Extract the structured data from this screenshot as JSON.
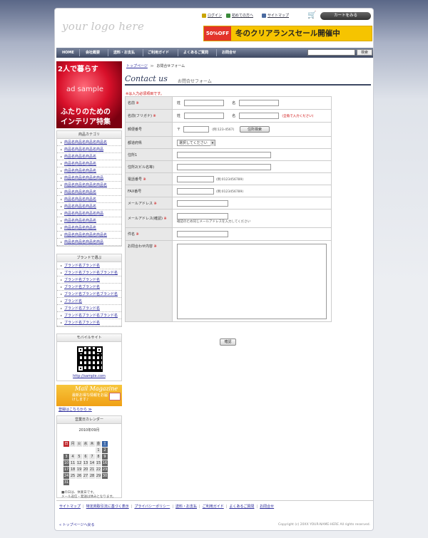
{
  "header": {
    "logo": "your logo here",
    "top_links": [
      "ログイン",
      "初めての方へ",
      "サイトマップ"
    ],
    "cart_button": "カートをみる",
    "banner_badge": "50%OFF",
    "banner_text": "冬のクリアランスセール開催中"
  },
  "nav": {
    "items": [
      "HOME",
      "会社概要",
      "送料・お支払",
      "ご利用ガイド",
      "よくあるご質問",
      "お問合せ"
    ],
    "search_button": "検索"
  },
  "side_ad": {
    "line1": "2人で暮らす",
    "line2": "ad sample",
    "line3": "ふたりのための",
    "line4": "インテリア特集"
  },
  "categories": {
    "title": "商品カテゴリ",
    "items": [
      "商品名商品名商品名商品名",
      "商品名商品名商品名商品",
      "商品名商品名商品名",
      "商品名商品名商品名",
      "商品名商品名商品名",
      "商品名商品名商品名商品",
      "商品名商品名商品名商品名",
      "商品名商品名商品名",
      "商品名商品名商品名",
      "商品名商品名商品名",
      "商品名商品名商品名商品",
      "商品名商品名商品名",
      "商品名商品名商品名",
      "商品名商品名商品名商品名",
      "商品名商品名商品名商品"
    ]
  },
  "brands": {
    "title": "ブランドで選ぶ",
    "items": [
      "ブランド名ブランド名",
      "ブランド名ブランド名ブランド名",
      "ブランド名ブランド名",
      "ブランド名ブランド名",
      "ブランド名ブランド名ブランド名",
      "ブランド名",
      "ブランド名ブランド名",
      "ブランド名ブランド名ブランド名",
      "ブランド名ブランド名"
    ]
  },
  "mobile": {
    "title": "モバイルサイト",
    "url": "http://sample.com"
  },
  "mail_magazine": {
    "title": "Mail Magazine",
    "text": "最新お得な情報をお届けします♪",
    "link": "登録はこちらから ≫"
  },
  "calendar": {
    "title": "営業日カレンダー",
    "month": "2010年09月",
    "weekdays": [
      "日",
      "月",
      "火",
      "水",
      "木",
      "金",
      "土"
    ],
    "rows": [
      [
        "",
        "",
        "",
        "",
        "",
        "1",
        "2"
      ],
      [
        "3",
        "4",
        "5",
        "6",
        "7",
        "8",
        "9"
      ],
      [
        "10",
        "11",
        "12",
        "13",
        "14",
        "15",
        "16"
      ],
      [
        "17",
        "18",
        "19",
        "20",
        "21",
        "22",
        "23"
      ],
      [
        "24",
        "25",
        "26",
        "27",
        "28",
        "29",
        "30"
      ],
      [
        "31",
        "",
        "",
        "",
        "",
        "",
        ""
      ]
    ],
    "note1": "■の日は、休業日です。",
    "note2": "メール返信・発送は休みとなります。"
  },
  "breadcrumb": {
    "home": "トップページ",
    "sep": "≫",
    "current": "お問合せフォーム"
  },
  "page": {
    "title_en": "Contact us",
    "title_jp": "お問合せフォーム",
    "required_note": "※は入力必須項目です。"
  },
  "form": {
    "name_label": "名前",
    "kana_label": "名前(フリガナ)",
    "sei": "姓",
    "mei": "名",
    "kana_hint": "(全角で入力ください)",
    "zip_label": "郵便番号",
    "zip_mark": "〒",
    "zip_hint": "(例:123-4567)",
    "zip_button": "住所検索",
    "pref_label": "都道府県",
    "pref_select": "選択してください",
    "addr1_label": "住所1",
    "addr2_label": "住所2(ビル名等)",
    "tel_label": "電話番号",
    "tel_hint": "(例:0123456789)",
    "fax_label": "FAX番号",
    "fax_hint": "(例:0123456789)",
    "email_label": "メールアドレス",
    "email2_label": "メールアドレス(確認)",
    "email2_hint": "確認のため同じメールアドレスを入力してください",
    "subject_label": "件名",
    "body_label": "お問合わせ内容",
    "required_mark": "※",
    "confirm_button": "確認"
  },
  "footer": {
    "links": [
      "サイトマップ",
      "特定商取引法に基づく表示",
      "プライバシーポリシー",
      "送料・お支払",
      "ご利用ガイド",
      "よくあるご質問",
      "お問合せ"
    ],
    "back": "トップページへ戻る",
    "copyright": "Copyright (c) 20XX YOUR-NAME-HERE All rights reserved."
  }
}
